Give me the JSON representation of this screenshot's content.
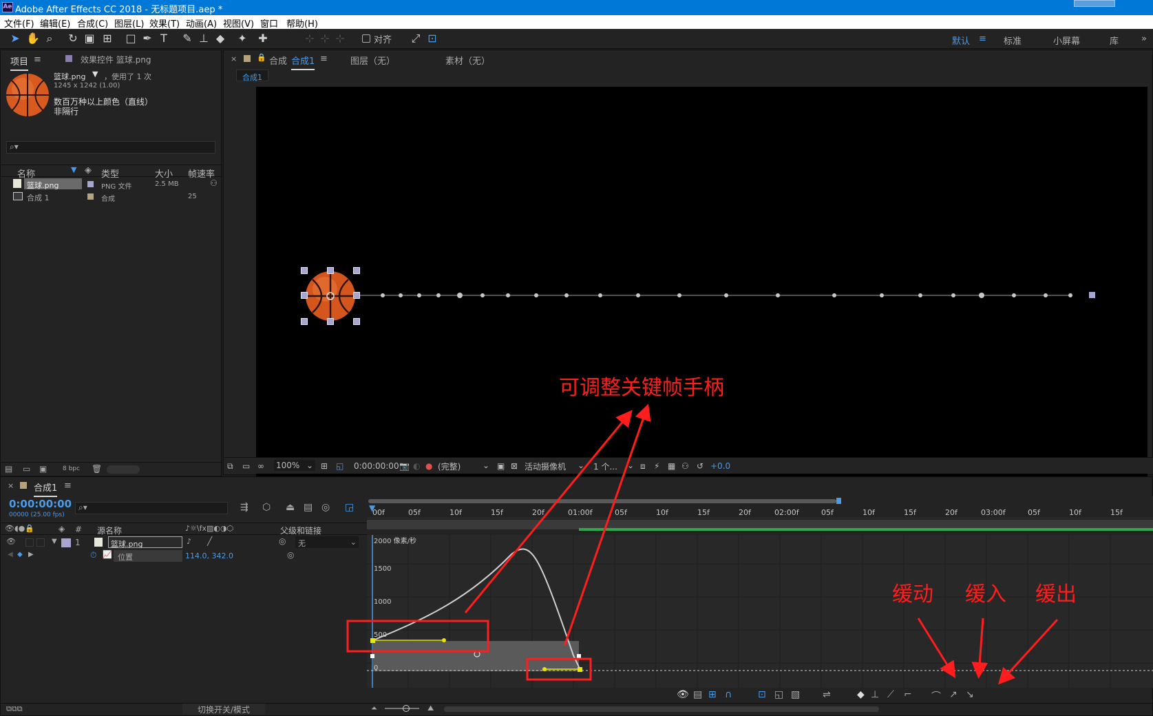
{
  "app": {
    "icon_label": "Ae",
    "title": "Adobe After Effects CC 2018 - 无标题项目.aep *"
  },
  "menu": [
    "文件(F)",
    "编辑(E)",
    "合成(C)",
    "图层(L)",
    "效果(T)",
    "动画(A)",
    "视图(V)",
    "窗口",
    "帮助(H)"
  ],
  "toolbar": {
    "align_label": "对齐",
    "workspaces": [
      "默认",
      "标准",
      "小屏幕",
      "库"
    ],
    "active_workspace": "默认"
  },
  "project": {
    "tab_label": "项目",
    "effects_tab_label": "效果控件 篮球.png",
    "item_name": "篮球.png",
    "used_text": "，使用了 1 次",
    "dimensions": "1245 x 1242 (1.00)",
    "color_info": "数百万种以上颜色（直线）",
    "interlace": "非隔行",
    "search_placeholder": "",
    "columns": [
      "名称",
      "类型",
      "大小",
      "帧速率"
    ],
    "rows": [
      {
        "name": "篮球.png",
        "type": "PNG 文件",
        "size": "2.5 MB",
        "fps": ""
      },
      {
        "name": "合成 1",
        "type": "合成",
        "size": "",
        "fps": "25"
      }
    ],
    "bpc": "8 bpc"
  },
  "composition": {
    "tab_label": "合成",
    "comp_name": "合成1",
    "layer_tab": "图层（无）",
    "footage_tab": "素材（无）",
    "breadcrumb": "合成1"
  },
  "viewer_controls": {
    "zoom": "100%",
    "timecode": "0:00:00:00",
    "resolution": "(完整)",
    "camera": "活动摄像机",
    "views": "1 个...",
    "exposure": "+0.0"
  },
  "timeline": {
    "tab_label": "合成1",
    "timecode": "0:00:00:00",
    "frame_info": "00000 (25.00 fps)",
    "col_headers": {
      "num": "#",
      "source": "源名称",
      "parent": "父级和链接"
    },
    "layer": {
      "index": "1",
      "name": "篮球.png",
      "parent": "无"
    },
    "property": {
      "name": "位置",
      "value": "114.0, 342.0"
    },
    "ruler": [
      "00f",
      "05f",
      "10f",
      "15f",
      "20f",
      "01:00f",
      "05f",
      "10f",
      "15f",
      "20f",
      "02:00f",
      "05f",
      "10f",
      "15f",
      "20f",
      "03:00f",
      "05f",
      "10f",
      "15f"
    ],
    "graph_axis": [
      "2000 像素/秒",
      "1500",
      "1000",
      "500",
      "0"
    ],
    "footer": "切换开关/模式"
  },
  "annotations": {
    "handle_label": "可调整关键帧手柄",
    "easy_ease": "缓动",
    "ease_in": "缓入",
    "ease_out": "缓出",
    "color": "#ff1d1d"
  }
}
